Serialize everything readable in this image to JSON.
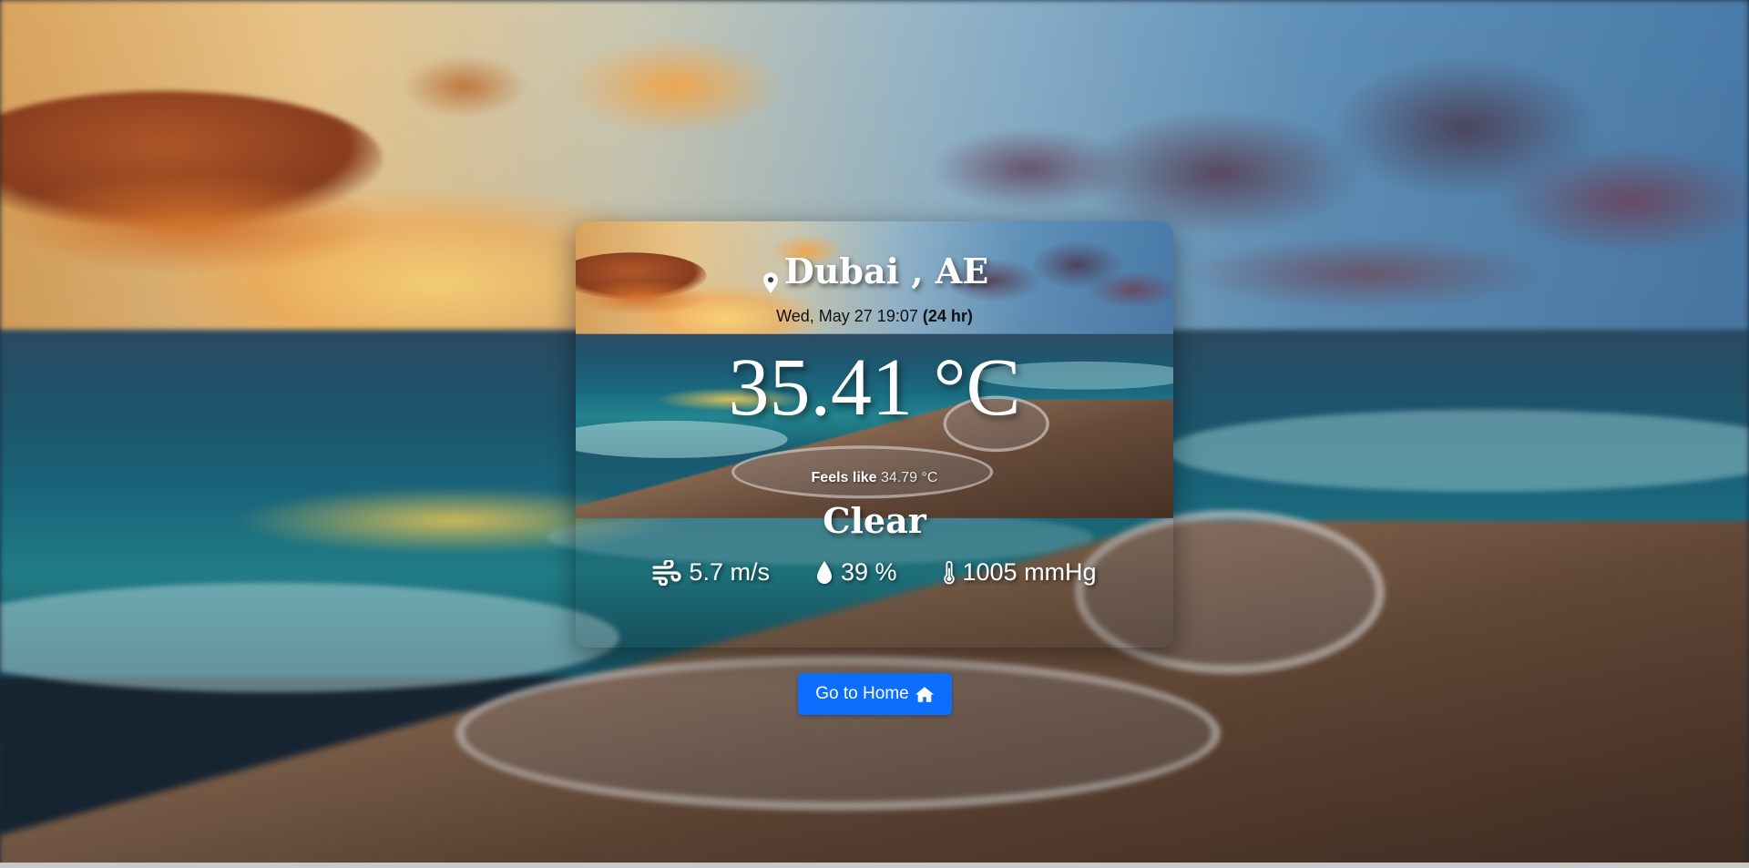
{
  "weather": {
    "city": "Dubai",
    "country": "AE",
    "location_text": "Dubai , AE",
    "datetime": "Wed, May 27 19:07",
    "time_format": "(24 hr)",
    "temperature": "35.41 °C",
    "feels_like_label": "Feels like",
    "feels_like_value": "34.79 °C",
    "condition": "Clear",
    "wind": "5.7 m/s",
    "humidity": "39 %",
    "pressure": "1005 mmHg"
  },
  "icons": {
    "location": "map-pin-icon",
    "wind": "wind-icon",
    "humidity": "droplet-icon",
    "pressure": "thermometer-icon",
    "home": "home-icon"
  },
  "actions": {
    "home_label": "Go to Home"
  },
  "colors": {
    "primary_button": "#0d6efd",
    "text": "#ffffff",
    "datetime_text": "#111111"
  }
}
